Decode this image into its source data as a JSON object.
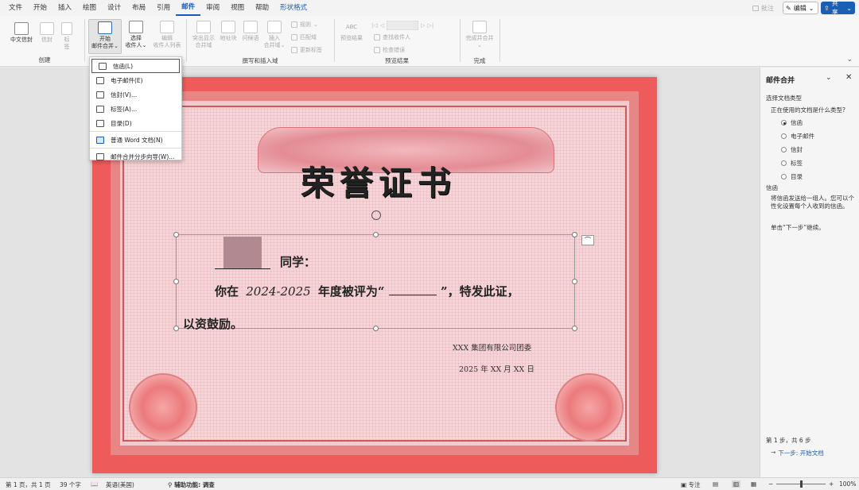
{
  "tabs": [
    "文件",
    "开始",
    "插入",
    "绘图",
    "设计",
    "布局",
    "引用",
    "邮件",
    "审阅",
    "视图",
    "帮助",
    "形状格式"
  ],
  "active_tab": "邮件",
  "top_right": {
    "comment": "批注",
    "edit": "编辑",
    "share": "共享"
  },
  "ribbon": {
    "groups": [
      "创建",
      "撰写和插入域",
      "预览结果",
      "完成"
    ],
    "chinese_envelope": "中文信封",
    "envelope": "信封",
    "label": "标签",
    "start_merge_1": "开始",
    "start_merge_2": "邮件合并",
    "select_recipients_1": "选择",
    "select_recipients_2": "收件人",
    "edit_recipients_1": "编辑",
    "edit_recipients_2": "收件人列表",
    "highlight_fields_1": "突出显示",
    "highlight_fields_2": "合并域",
    "address_block": "地址块",
    "greeting_line": "问候语",
    "insert_field_1": "插入",
    "insert_field_2": "合并域",
    "rules": "规则",
    "match_fields": "匹配域",
    "update_labels": "更新标签",
    "preview_abc": "ABC",
    "preview_results": "预览结果",
    "find_recipient": "查找收件人",
    "check_errors": "检查错误",
    "finish_merge": "完成并合并"
  },
  "dropdown": {
    "items": [
      "信函(L)",
      "电子邮件(E)",
      "信封(V)...",
      "标签(A)...",
      "目录(D)",
      "普通 Word 文档(N)",
      "邮件合并分步向导(W)..."
    ],
    "icons": [
      "letter-icon",
      "email-icon",
      "envelope-icon",
      "label-icon",
      "directory-icon",
      "word-doc-icon",
      "wizard-icon"
    ]
  },
  "certificate": {
    "title": "荣誉证书",
    "line1_suffix": "同学：",
    "line2_prefix": "你在",
    "line2_year": "2024-2025",
    "line2_mid": "年度被评为“",
    "line2_suffix": "”，特发此证，",
    "line3": "以资鼓励。",
    "org": "XXX 集团有限公司团委",
    "date": "2025 年 XX 月 XX 日"
  },
  "pane": {
    "title": "邮件合并",
    "section1": "选择文档类型",
    "question": "正在使用的文档是什么类型?",
    "options": [
      "信函",
      "电子邮件",
      "信封",
      "标签",
      "目录"
    ],
    "selected": "信函",
    "section2": "信函",
    "desc": "将信函发送给一组人。您可以个性化设置每个人收到的信函。",
    "instruction": "单击“下一步”继续。",
    "step": "第 1 步，共 6 步",
    "next": "下一步: 开始文档"
  },
  "status": {
    "page": "第 1 页，共 1 页",
    "words": "39 个字",
    "lang": "英语(美国)",
    "access": "辅助功能: 调查",
    "focus": "专注",
    "zoom": "100%"
  },
  "colors": {
    "accent": "#185abd",
    "cert_red": "#ee5b5b",
    "share": "#1a5fb4"
  }
}
